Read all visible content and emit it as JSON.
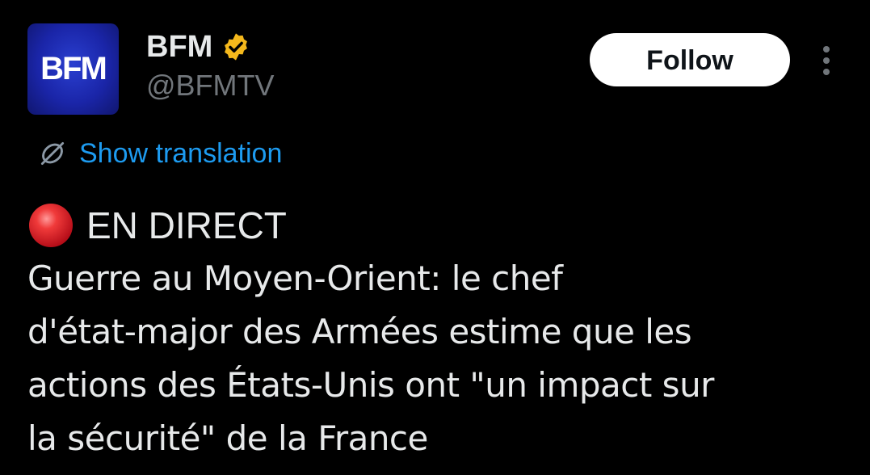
{
  "author": {
    "avatar_logo_text": "BFM",
    "display_name": "BFM",
    "handle": "@BFMTV",
    "verified_icon": "verified-badge-gold",
    "verified_color": "#f4b81c",
    "avatar_color": "#1a25a8"
  },
  "actions": {
    "follow_label": "Follow",
    "more_icon": "more-vertical-icon"
  },
  "translation": {
    "icon": "globe-translate-icon",
    "label": "Show translation",
    "link_color": "#1d9bf0"
  },
  "tweet": {
    "live_emoji": "red-circle-icon",
    "live_label": "EN DIRECT",
    "text_lines": [
      "Guerre au Moyen-Orient: le chef",
      "d'état-major des Armées estime que les",
      "actions des États-Unis ont \"un impact sur",
      "la sécurité\" de la France"
    ]
  },
  "colors": {
    "background": "#000000",
    "text": "#e7e9ea",
    "secondary_text": "#71767b"
  }
}
